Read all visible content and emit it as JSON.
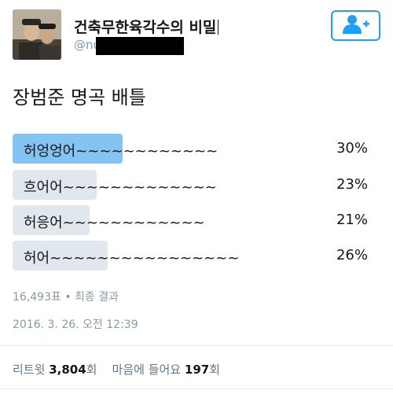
{
  "header": {
    "display_name": "건축무한육각수의 비밀",
    "handle_prefix": "@nu",
    "follow_icon": "add-user-icon",
    "accent_color": "#1da1f2"
  },
  "tweet": {
    "text": "장범준 명곡 배틀"
  },
  "poll": {
    "options": [
      {
        "label": "허엉엉어~~~~~~~~~~~~",
        "percent": "30%",
        "value": 30,
        "winner": true
      },
      {
        "label": "흐어어~~~~~~~~~~~~~",
        "percent": "23%",
        "value": 23,
        "winner": false
      },
      {
        "label": "허응어~~~~~~~~~~~~",
        "percent": "21%",
        "value": 21,
        "winner": false
      },
      {
        "label": "허어~~~~~~~~~~~~~~~~",
        "percent": "26%",
        "value": 26,
        "winner": false
      }
    ],
    "votes_text": "16,493표 • 최종 결과",
    "winner_color": "#84c3f2",
    "bar_color": "#e1e8ed"
  },
  "timestamp": "2016. 3. 26. 오전 12:39",
  "stats": {
    "retweet_label": "리트윗",
    "retweet_count": "3,804",
    "retweet_unit": "회",
    "like_label": "마음에 들어요",
    "like_count": "197",
    "like_unit": "회"
  }
}
